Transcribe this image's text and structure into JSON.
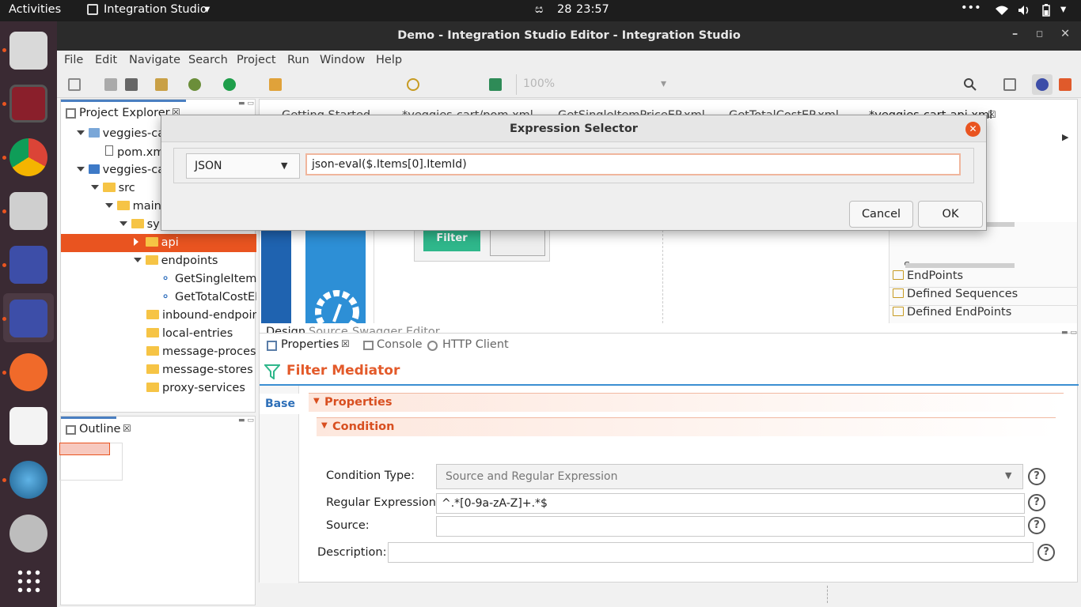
{
  "system": {
    "activities": "Activities",
    "app_menu": "Integration Studio",
    "date": "28",
    "time": "23:57",
    "lang": "ස"
  },
  "window": {
    "title": "Demo - Integration Studio Editor - Integration Studio"
  },
  "menu": [
    "File",
    "Edit",
    "Navigate",
    "Search",
    "Project",
    "Run",
    "Window",
    "Help"
  ],
  "toolbar": {
    "zoom": "100%"
  },
  "project_explorer": {
    "tab": "Project Explorer",
    "items": [
      "veggies-car",
      "pom.xm",
      "veggies-car",
      "src",
      "main",
      "synapse-config",
      "api",
      "endpoints",
      "GetSingleItemP",
      "GetTotalCostEF",
      "inbound-endpoint",
      "local-entries",
      "message-processo",
      "message-stores",
      "proxy-services"
    ]
  },
  "editor_tabs": [
    "Getting Started",
    "*veggies-cart/pom.xml",
    "GetSingleItemPriceEP.xml",
    "GetTotalCostEP.xml",
    "*veggies-cart-api.xml"
  ],
  "canvas": {
    "filter_label": "Filter",
    "bottom_tabs": [
      "Design",
      "Source",
      "Swagger Editor"
    ]
  },
  "palette": {
    "sequence": "Sequence",
    "groups": [
      "EndPoints",
      "Defined Sequences",
      "Defined EndPoints"
    ]
  },
  "outline": {
    "tab": "Outline"
  },
  "bottom_tabs": [
    "Properties",
    "Console",
    "HTTP Client"
  ],
  "properties": {
    "title": "Filter Mediator",
    "side_tab": "Base",
    "section": "Properties",
    "subsection": "Condition",
    "condition_type_label": "Condition Type:",
    "condition_type_value": "Source and Regular Expression",
    "regex_label": "Regular Expression:",
    "regex_value": "^.*[0-9a-zA-Z]+.*$",
    "source_label": "Source:",
    "source_value": "",
    "description_label": "Description:",
    "description_value": "",
    "help": "?"
  },
  "dialog": {
    "title": "Expression Selector",
    "type_value": "JSON",
    "expression": "json-eval($.Items[0].ItemId)",
    "cancel": "Cancel",
    "ok": "OK"
  }
}
